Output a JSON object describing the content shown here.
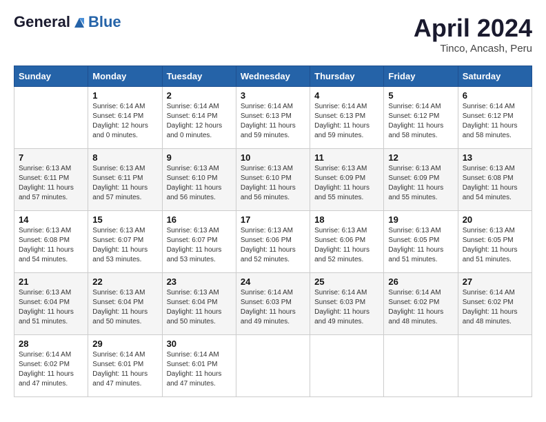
{
  "header": {
    "logo_line1": "General",
    "logo_line2": "Blue",
    "month_title": "April 2024",
    "location": "Tinco, Ancash, Peru"
  },
  "columns": [
    "Sunday",
    "Monday",
    "Tuesday",
    "Wednesday",
    "Thursday",
    "Friday",
    "Saturday"
  ],
  "weeks": [
    [
      {
        "day": "",
        "sunrise": "",
        "sunset": "",
        "daylight": ""
      },
      {
        "day": "1",
        "sunrise": "Sunrise: 6:14 AM",
        "sunset": "Sunset: 6:14 PM",
        "daylight": "Daylight: 12 hours and 0 minutes."
      },
      {
        "day": "2",
        "sunrise": "Sunrise: 6:14 AM",
        "sunset": "Sunset: 6:14 PM",
        "daylight": "Daylight: 12 hours and 0 minutes."
      },
      {
        "day": "3",
        "sunrise": "Sunrise: 6:14 AM",
        "sunset": "Sunset: 6:13 PM",
        "daylight": "Daylight: 11 hours and 59 minutes."
      },
      {
        "day": "4",
        "sunrise": "Sunrise: 6:14 AM",
        "sunset": "Sunset: 6:13 PM",
        "daylight": "Daylight: 11 hours and 59 minutes."
      },
      {
        "day": "5",
        "sunrise": "Sunrise: 6:14 AM",
        "sunset": "Sunset: 6:12 PM",
        "daylight": "Daylight: 11 hours and 58 minutes."
      },
      {
        "day": "6",
        "sunrise": "Sunrise: 6:14 AM",
        "sunset": "Sunset: 6:12 PM",
        "daylight": "Daylight: 11 hours and 58 minutes."
      }
    ],
    [
      {
        "day": "7",
        "sunrise": "Sunrise: 6:13 AM",
        "sunset": "Sunset: 6:11 PM",
        "daylight": "Daylight: 11 hours and 57 minutes."
      },
      {
        "day": "8",
        "sunrise": "Sunrise: 6:13 AM",
        "sunset": "Sunset: 6:11 PM",
        "daylight": "Daylight: 11 hours and 57 minutes."
      },
      {
        "day": "9",
        "sunrise": "Sunrise: 6:13 AM",
        "sunset": "Sunset: 6:10 PM",
        "daylight": "Daylight: 11 hours and 56 minutes."
      },
      {
        "day": "10",
        "sunrise": "Sunrise: 6:13 AM",
        "sunset": "Sunset: 6:10 PM",
        "daylight": "Daylight: 11 hours and 56 minutes."
      },
      {
        "day": "11",
        "sunrise": "Sunrise: 6:13 AM",
        "sunset": "Sunset: 6:09 PM",
        "daylight": "Daylight: 11 hours and 55 minutes."
      },
      {
        "day": "12",
        "sunrise": "Sunrise: 6:13 AM",
        "sunset": "Sunset: 6:09 PM",
        "daylight": "Daylight: 11 hours and 55 minutes."
      },
      {
        "day": "13",
        "sunrise": "Sunrise: 6:13 AM",
        "sunset": "Sunset: 6:08 PM",
        "daylight": "Daylight: 11 hours and 54 minutes."
      }
    ],
    [
      {
        "day": "14",
        "sunrise": "Sunrise: 6:13 AM",
        "sunset": "Sunset: 6:08 PM",
        "daylight": "Daylight: 11 hours and 54 minutes."
      },
      {
        "day": "15",
        "sunrise": "Sunrise: 6:13 AM",
        "sunset": "Sunset: 6:07 PM",
        "daylight": "Daylight: 11 hours and 53 minutes."
      },
      {
        "day": "16",
        "sunrise": "Sunrise: 6:13 AM",
        "sunset": "Sunset: 6:07 PM",
        "daylight": "Daylight: 11 hours and 53 minutes."
      },
      {
        "day": "17",
        "sunrise": "Sunrise: 6:13 AM",
        "sunset": "Sunset: 6:06 PM",
        "daylight": "Daylight: 11 hours and 52 minutes."
      },
      {
        "day": "18",
        "sunrise": "Sunrise: 6:13 AM",
        "sunset": "Sunset: 6:06 PM",
        "daylight": "Daylight: 11 hours and 52 minutes."
      },
      {
        "day": "19",
        "sunrise": "Sunrise: 6:13 AM",
        "sunset": "Sunset: 6:05 PM",
        "daylight": "Daylight: 11 hours and 51 minutes."
      },
      {
        "day": "20",
        "sunrise": "Sunrise: 6:13 AM",
        "sunset": "Sunset: 6:05 PM",
        "daylight": "Daylight: 11 hours and 51 minutes."
      }
    ],
    [
      {
        "day": "21",
        "sunrise": "Sunrise: 6:13 AM",
        "sunset": "Sunset: 6:04 PM",
        "daylight": "Daylight: 11 hours and 51 minutes."
      },
      {
        "day": "22",
        "sunrise": "Sunrise: 6:13 AM",
        "sunset": "Sunset: 6:04 PM",
        "daylight": "Daylight: 11 hours and 50 minutes."
      },
      {
        "day": "23",
        "sunrise": "Sunrise: 6:13 AM",
        "sunset": "Sunset: 6:04 PM",
        "daylight": "Daylight: 11 hours and 50 minutes."
      },
      {
        "day": "24",
        "sunrise": "Sunrise: 6:14 AM",
        "sunset": "Sunset: 6:03 PM",
        "daylight": "Daylight: 11 hours and 49 minutes."
      },
      {
        "day": "25",
        "sunrise": "Sunrise: 6:14 AM",
        "sunset": "Sunset: 6:03 PM",
        "daylight": "Daylight: 11 hours and 49 minutes."
      },
      {
        "day": "26",
        "sunrise": "Sunrise: 6:14 AM",
        "sunset": "Sunset: 6:02 PM",
        "daylight": "Daylight: 11 hours and 48 minutes."
      },
      {
        "day": "27",
        "sunrise": "Sunrise: 6:14 AM",
        "sunset": "Sunset: 6:02 PM",
        "daylight": "Daylight: 11 hours and 48 minutes."
      }
    ],
    [
      {
        "day": "28",
        "sunrise": "Sunrise: 6:14 AM",
        "sunset": "Sunset: 6:02 PM",
        "daylight": "Daylight: 11 hours and 47 minutes."
      },
      {
        "day": "29",
        "sunrise": "Sunrise: 6:14 AM",
        "sunset": "Sunset: 6:01 PM",
        "daylight": "Daylight: 11 hours and 47 minutes."
      },
      {
        "day": "30",
        "sunrise": "Sunrise: 6:14 AM",
        "sunset": "Sunset: 6:01 PM",
        "daylight": "Daylight: 11 hours and 47 minutes."
      },
      {
        "day": "",
        "sunrise": "",
        "sunset": "",
        "daylight": ""
      },
      {
        "day": "",
        "sunrise": "",
        "sunset": "",
        "daylight": ""
      },
      {
        "day": "",
        "sunrise": "",
        "sunset": "",
        "daylight": ""
      },
      {
        "day": "",
        "sunrise": "",
        "sunset": "",
        "daylight": ""
      }
    ]
  ]
}
